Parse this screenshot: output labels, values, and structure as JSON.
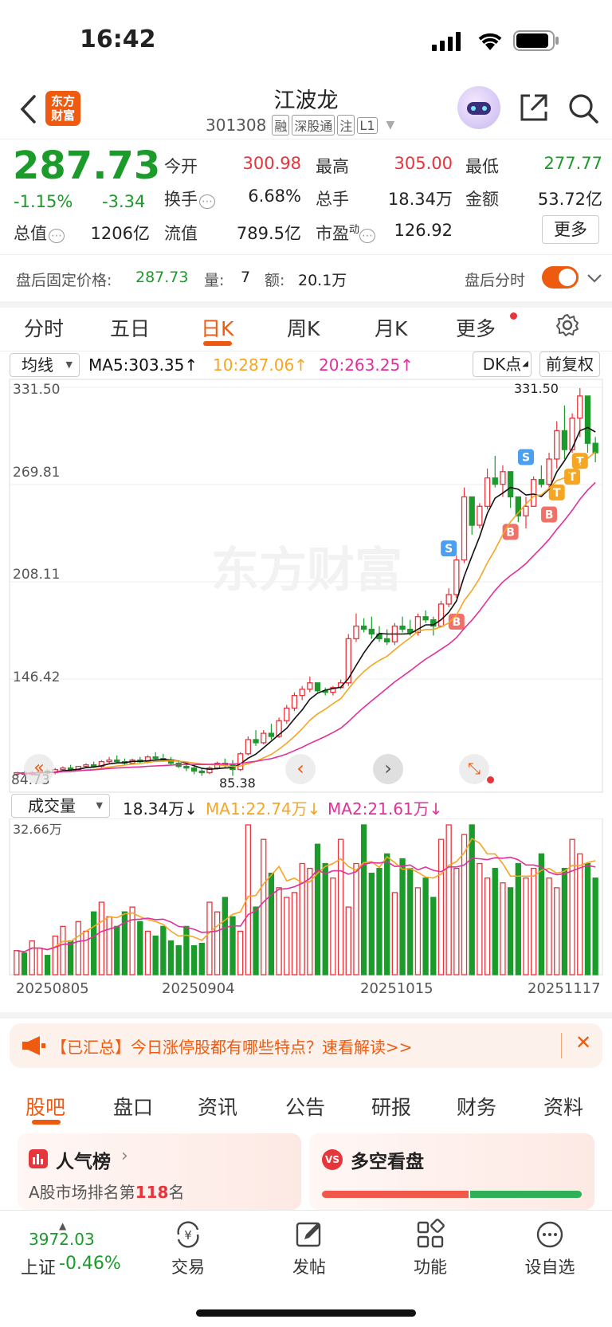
{
  "status": {
    "time": "16:42"
  },
  "header": {
    "logo": "东方\n财富",
    "stock_name": "江波龙",
    "code": "301308",
    "badges": [
      "融",
      "深股通",
      "注",
      "L1"
    ]
  },
  "quote": {
    "price": "287.73",
    "change_pct": "-1.15%",
    "change_abs": "-3.34",
    "open_label": "今开",
    "open": "300.98",
    "high_label": "最高",
    "high": "305.00",
    "low_label": "最低",
    "low": "277.77",
    "turnover_label": "换手",
    "turnover": "6.68%",
    "volume_label": "总手",
    "volume": "18.34万",
    "amount_label": "金额",
    "amount": "53.72亿",
    "mktcap_label": "总值",
    "mktcap": "1206亿",
    "float_label": "流值",
    "float_cap": "789.5亿",
    "pe_label": "市盈",
    "pe_sup": "动",
    "pe": "126.92",
    "more_label": "更多"
  },
  "after_hours": {
    "label": "盘后固定价格:",
    "price": "287.73",
    "vol_label": "量:",
    "vol": "7",
    "amt_label": "额:",
    "amt": "20.1万",
    "toggle_label": "盘后分时"
  },
  "period_tabs": [
    "分时",
    "五日",
    "日K",
    "周K",
    "月K",
    "更多"
  ],
  "ma_bar": {
    "select": "均线",
    "ma5": "MA5:303.35↑",
    "ma10": "10:287.06↑",
    "ma20": "20:263.25↑",
    "dk_label": "DK点",
    "adjust_label": "前复权"
  },
  "chart_labels": {
    "y_top": "331.50",
    "y2": "269.81",
    "y3": "208.11",
    "y4": "146.42",
    "y_bottom": "84.73",
    "high_mark": "331.50",
    "low_mark": "85.38",
    "watermark": "东方财富"
  },
  "vol_bar": {
    "select": "成交量",
    "vol": "18.34万↓",
    "ma1": "MA1:22.74万↓",
    "ma2": "MA2:21.61万↓",
    "vol_top": "32.66万"
  },
  "dates": [
    "20250805",
    "20250904",
    "20251015",
    "20251117"
  ],
  "colors": {
    "up": "#e8343b",
    "down": "#1a9b2a",
    "ma5": "#111111",
    "ma10": "#f5a623",
    "ma20": "#e0309a",
    "accent": "#ee5a0f"
  },
  "chart_data": {
    "type": "candlestick",
    "ylim": [
      84.73,
      331.5
    ],
    "candles": [
      [
        86,
        87,
        85,
        87
      ],
      [
        87,
        88,
        86,
        86
      ],
      [
        86,
        88,
        85,
        87
      ],
      [
        87,
        89,
        86,
        88
      ],
      [
        88,
        89,
        86,
        87
      ],
      [
        87,
        90,
        86,
        89
      ],
      [
        89,
        91,
        88,
        90
      ],
      [
        90,
        92,
        89,
        89
      ],
      [
        89,
        91,
        88,
        91
      ],
      [
        91,
        93,
        90,
        92
      ],
      [
        92,
        94,
        90,
        91
      ],
      [
        91,
        95,
        90,
        94
      ],
      [
        94,
        97,
        93,
        95
      ],
      [
        95,
        98,
        93,
        94
      ],
      [
        94,
        96,
        92,
        93
      ],
      [
        93,
        96,
        92,
        95
      ],
      [
        95,
        97,
        93,
        94
      ],
      [
        94,
        98,
        93,
        97
      ],
      [
        97,
        100,
        95,
        96
      ],
      [
        96,
        99,
        94,
        95
      ],
      [
        95,
        97,
        92,
        93
      ],
      [
        93,
        95,
        90,
        91
      ],
      [
        91,
        93,
        88,
        90
      ],
      [
        90,
        92,
        86,
        88
      ],
      [
        88,
        90,
        85,
        87
      ],
      [
        87,
        91,
        86,
        90
      ],
      [
        90,
        94,
        89,
        93
      ],
      [
        93,
        96,
        90,
        92
      ],
      [
        92,
        95,
        85,
        89
      ],
      [
        89,
        100,
        88,
        99
      ],
      [
        99,
        110,
        98,
        108
      ],
      [
        108,
        114,
        104,
        106
      ],
      [
        106,
        114,
        105,
        112
      ],
      [
        112,
        118,
        108,
        110
      ],
      [
        110,
        122,
        109,
        120
      ],
      [
        120,
        130,
        118,
        128
      ],
      [
        128,
        138,
        126,
        136
      ],
      [
        136,
        142,
        133,
        140
      ],
      [
        140,
        148,
        138,
        144
      ],
      [
        144,
        142,
        138,
        139
      ],
      [
        139,
        141,
        136,
        138
      ],
      [
        138,
        142,
        136,
        141
      ],
      [
        141,
        146,
        140,
        144
      ],
      [
        144,
        175,
        142,
        172
      ],
      [
        172,
        188,
        170,
        180
      ],
      [
        180,
        185,
        176,
        178
      ],
      [
        178,
        186,
        172,
        175
      ],
      [
        175,
        180,
        170,
        172
      ],
      [
        172,
        178,
        168,
        170
      ],
      [
        170,
        182,
        168,
        180
      ],
      [
        180,
        186,
        176,
        178
      ],
      [
        178,
        184,
        174,
        176
      ],
      [
        176,
        188,
        174,
        186
      ],
      [
        186,
        190,
        182,
        184
      ],
      [
        184,
        186,
        174,
        180
      ],
      [
        180,
        196,
        190,
        194
      ],
      [
        194,
        204,
        192,
        200
      ],
      [
        200,
        225,
        198,
        222
      ],
      [
        222,
        268,
        220,
        262
      ],
      [
        262,
        262,
        238,
        244
      ],
      [
        244,
        258,
        242,
        256
      ],
      [
        256,
        280,
        254,
        274
      ],
      [
        274,
        288,
        268,
        270
      ],
      [
        270,
        282,
        262,
        278
      ],
      [
        278,
        276,
        255,
        262
      ],
      [
        262,
        256,
        246,
        250
      ],
      [
        250,
        262,
        242,
        256
      ],
      [
        256,
        275,
        262,
        273
      ],
      [
        273,
        282,
        268,
        270
      ],
      [
        270,
        290,
        266,
        286
      ],
      [
        286,
        310,
        280,
        304
      ],
      [
        304,
        320,
        286,
        292
      ],
      [
        292,
        315,
        290,
        312
      ],
      [
        312,
        331,
        300,
        326
      ],
      [
        326,
        310,
        290,
        296
      ],
      [
        296,
        300,
        284,
        290
      ]
    ],
    "markers": [
      {
        "type": "S",
        "label": "S"
      },
      {
        "type": "S",
        "label": "S"
      },
      {
        "type": "B",
        "label": "B"
      },
      {
        "type": "B",
        "label": "B"
      },
      {
        "type": "B",
        "label": "B"
      },
      {
        "type": "T",
        "label": "T"
      },
      {
        "type": "T",
        "label": "T"
      },
      {
        "type": "T",
        "label": "T"
      }
    ],
    "volume": [
      10,
      9,
      14,
      11,
      8,
      16,
      20,
      14,
      22,
      18,
      26,
      30,
      24,
      20,
      26,
      28,
      22,
      18,
      16,
      20,
      14,
      12,
      20,
      12,
      13,
      30,
      26,
      32,
      24,
      18,
      62,
      28,
      56,
      42,
      36,
      32,
      34,
      46,
      44,
      54,
      46,
      40,
      56,
      28,
      46,
      62,
      42,
      44,
      50,
      34,
      48,
      44,
      36,
      40,
      32,
      56,
      62,
      44,
      58,
      62,
      46,
      40,
      44,
      38,
      36,
      46,
      40,
      44,
      50,
      40,
      36,
      44,
      56,
      50,
      46,
      40
    ],
    "x_dates": [
      "20250805",
      "20250904",
      "20251015",
      "20251117"
    ]
  },
  "news_banner": {
    "text": "【已汇总】今日涨停股都有哪些特点？速看解读>>"
  },
  "info_tabs": [
    "股吧",
    "盘口",
    "资讯",
    "公告",
    "研报",
    "财务",
    "资料"
  ],
  "cards": {
    "left_title": "人气榜",
    "left_sub_prefix": "A股市场排名第",
    "left_rank": "118",
    "left_sub_suffix": "名",
    "right_title": "多空看盘"
  },
  "bottom_nav": {
    "index_value": "3972.03",
    "index_name": "上证",
    "index_change": "-0.46%",
    "items": [
      "交易",
      "发帖",
      "功能",
      "设自选"
    ]
  }
}
